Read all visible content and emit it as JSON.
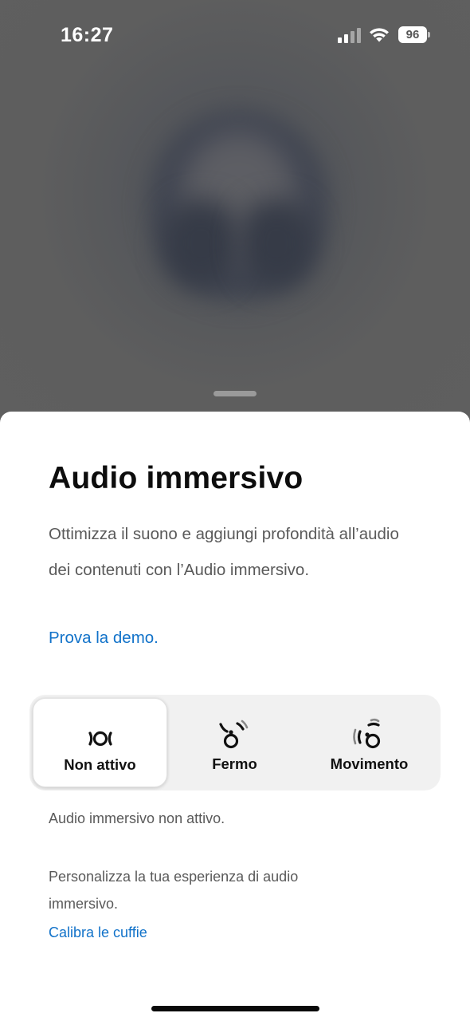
{
  "status_bar": {
    "time": "16:27",
    "battery": "96",
    "signal_icon": "cellular-signal-icon",
    "wifi_icon": "wifi-icon",
    "battery_icon": "battery-icon"
  },
  "sheet": {
    "title": "Audio immersivo",
    "description": "Ottimizza il suono e aggiungi profondità all’audio dei contenuti con l’Audio immersivo.",
    "demo_link": "Prova la demo.",
    "modes": [
      {
        "label": "Non attivo",
        "icon": "head-off-icon",
        "selected": true
      },
      {
        "label": "Fermo",
        "icon": "head-still-icon",
        "selected": false
      },
      {
        "label": "Movimento",
        "icon": "head-motion-icon",
        "selected": false
      }
    ],
    "state_text": "Audio immersivo non attivo.",
    "personalize_text": "Personalizza la tua esperienza di audio immersivo.",
    "calibrate_link": "Calibra le cuffie"
  },
  "colors": {
    "link": "#1172c9",
    "backdrop": "#5c5c5c",
    "sheet": "#ffffff",
    "segment_track": "#f1f1f1"
  }
}
